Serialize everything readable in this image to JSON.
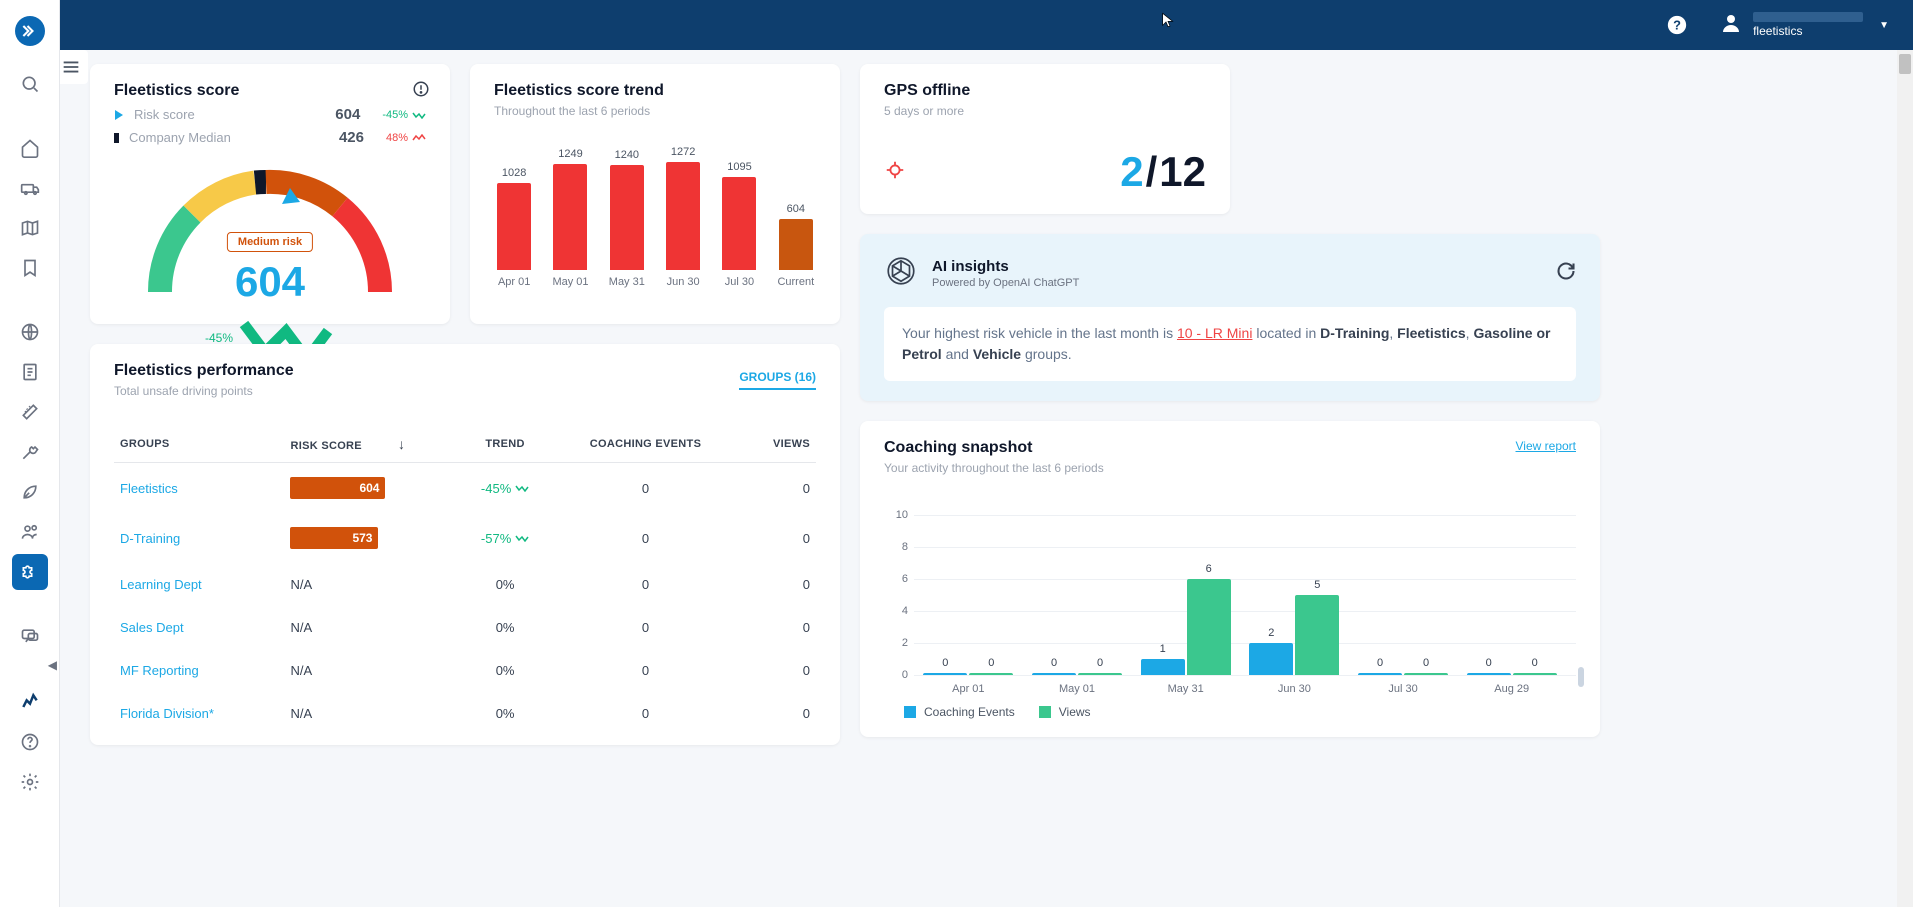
{
  "header": {
    "brand": "fleetistics"
  },
  "score_card": {
    "title": "Fleetistics score",
    "risk_label": "Risk score",
    "risk_value": "604",
    "risk_pct": "-45%",
    "median_label": "Company Median",
    "median_value": "426",
    "median_pct": "48%",
    "risk_badge": "Medium risk",
    "big_value": "604",
    "big_pct": "-45%"
  },
  "trend_card": {
    "title": "Fleetistics score trend",
    "sub": "Throughout the last 6 periods"
  },
  "chart_data": {
    "trend": {
      "type": "bar",
      "categories": [
        "Apr 01",
        "May 01",
        "May 31",
        "Jun 30",
        "Jul 30",
        "Current"
      ],
      "values": [
        1028,
        1249,
        1240,
        1272,
        1095,
        604
      ],
      "title": "Fleetistics score trend",
      "ylim": [
        0,
        1300
      ]
    },
    "coaching": {
      "type": "bar",
      "categories": [
        "Apr 01",
        "May 01",
        "May 31",
        "Jun 30",
        "Jul 30",
        "Aug 29"
      ],
      "series": [
        {
          "name": "Coaching Events",
          "values": [
            0,
            0,
            1,
            2,
            0,
            0
          ]
        },
        {
          "name": "Views",
          "values": [
            0,
            0,
            6,
            5,
            0,
            0
          ]
        }
      ],
      "ylim": [
        0,
        10
      ],
      "yticks": [
        0,
        2,
        4,
        6,
        8,
        10
      ]
    }
  },
  "gps_card": {
    "title": "GPS offline",
    "sub": "5 days or more",
    "numerator": "2",
    "denom": "12"
  },
  "ai_card": {
    "title": "AI insights",
    "sub": "Powered by OpenAI ChatGPT",
    "text_pre": "Your highest risk vehicle in the last month is ",
    "link": "10 - LR Mini",
    "text_mid": " located in ",
    "b1": "D-Training",
    "b2": "Fleetistics",
    "b3": "Gasoline or Petrol",
    "b4": "Vehicle",
    "and": " and ",
    "groups_suffix": " groups."
  },
  "perf_card": {
    "title": "Fleetistics performance",
    "sub": "Total unsafe driving points",
    "groups_link": "GROUPS (16)",
    "cols": {
      "groups": "GROUPS",
      "risk": "RISK SCORE",
      "trend": "TREND",
      "events": "COACHING EVENTS",
      "views": "VIEWS"
    },
    "rows": [
      {
        "name": "Fleetistics",
        "risk": "604",
        "riskbar": true,
        "trend": "-45%",
        "events": "0",
        "views": "0"
      },
      {
        "name": "D-Training",
        "risk": "573",
        "riskbar": true,
        "riskbarsm": true,
        "trend": "-57%",
        "events": "0",
        "views": "0"
      },
      {
        "name": "Learning Dept",
        "risk": "N/A",
        "trend": "0%",
        "events": "0",
        "views": "0"
      },
      {
        "name": "Sales Dept",
        "risk": "N/A",
        "trend": "0%",
        "events": "0",
        "views": "0"
      },
      {
        "name": "MF Reporting",
        "risk": "N/A",
        "trend": "0%",
        "events": "0",
        "views": "0"
      },
      {
        "name": "Florida Division*",
        "risk": "N/A",
        "trend": "0%",
        "events": "0",
        "views": "0"
      }
    ]
  },
  "coach_card": {
    "title": "Coaching snapshot",
    "sub": "Your activity throughout the last 6 periods",
    "view_report": "View report",
    "legend": {
      "a": "Coaching Events",
      "b": "Views"
    }
  }
}
